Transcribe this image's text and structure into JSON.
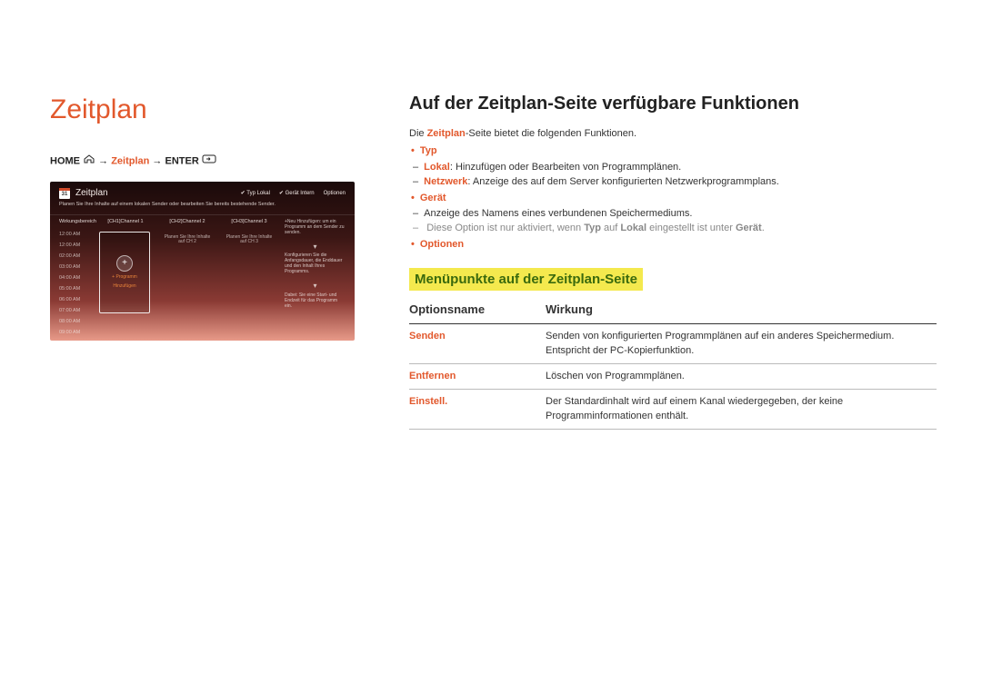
{
  "left": {
    "title": "Zeitplan",
    "breadcrumb": {
      "home": "HOME",
      "arrow": "→",
      "zeitplan": "Zeitplan",
      "enter": "ENTER"
    },
    "screenshot": {
      "cal_day": "31",
      "title": "Zeitplan",
      "top_right": {
        "typ": "Typ   Lokal",
        "geraet": "Gerät   Intern",
        "optionen": "Optionen"
      },
      "sub": "Planen Sie Ihre Inhalte auf einem lokalen Sender oder bearbeiten Sie bereits bestehende Sender.",
      "times_head": "Wirkungsbereich",
      "times": [
        "12:00 AM",
        "12:00 AM",
        "02:00 AM",
        "03:00 AM",
        "04:00 AM",
        "05:00 AM",
        "06:00 AM",
        "07:00 AM",
        "08:00 AM",
        "09:00 AM"
      ],
      "channels": {
        "ch1": "[CH1]Channel 1",
        "ch2": "[CH2]Channel 2",
        "ch3": "[CH3]Channel 3"
      },
      "card": {
        "plus": "+",
        "line1": "+ Programm",
        "line2": "Hinzufügen"
      },
      "ch_hint": "Planen Sie Ihre Inhalte auf CH 2",
      "ch_hint3": "Planen Sie Ihre Inhalte auf CH 3",
      "right_info": {
        "b1": "+Neu Hinzufügen: um ein Programm an dem Sender zu senden.",
        "b2": "Konfigurieren Sie die Anfangsdauer, die Enddauer und den Inhalt Ihres Programms.",
        "b3": "Dabei: Sie eine Start- und Endzeit für das Programm ein."
      }
    }
  },
  "right": {
    "section_title": "Auf der Zeitplan-Seite verfügbare Funktionen",
    "intro_pre": "Die ",
    "intro_accent": "Zeitplan",
    "intro_post": "-Seite bietet die folgenden Funktionen.",
    "bullets": {
      "typ": "Typ",
      "typ_sub1_accent": "Lokal",
      "typ_sub1_rest": ": Hinzufügen oder Bearbeiten von Programmplänen.",
      "typ_sub2_accent": "Netzwerk",
      "typ_sub2_rest": ": Anzeige des auf dem Server konfigurierten Netzwerkprogrammplans.",
      "geraet": "Gerät",
      "geraet_sub1": "Anzeige des Namens eines verbundenen Speichermediums.",
      "geraet_note_pre": "Diese Option ist nur aktiviert, wenn ",
      "geraet_note_typ": "Typ",
      "geraet_note_mid": " auf ",
      "geraet_note_lokal": "Lokal",
      "geraet_note_mid2": " eingestellt ist unter ",
      "geraet_note_geraet": "Gerät",
      "geraet_note_end": ".",
      "optionen": "Optionen"
    },
    "sub_heading": "Menüpunkte auf der Zeitplan-Seite",
    "table": {
      "head_name": "Optionsname",
      "head_effect": "Wirkung",
      "rows": [
        {
          "name": "Senden",
          "effect": "Senden von konfigurierten Programmplänen auf ein anderes Speichermedium. Entspricht der PC-Kopierfunktion."
        },
        {
          "name": "Entfernen",
          "effect": "Löschen von Programmplänen."
        },
        {
          "name": "Einstell.",
          "effect": "Der Standardinhalt wird auf einem Kanal wiedergegeben, der keine Programminformationen enthält."
        }
      ]
    }
  }
}
